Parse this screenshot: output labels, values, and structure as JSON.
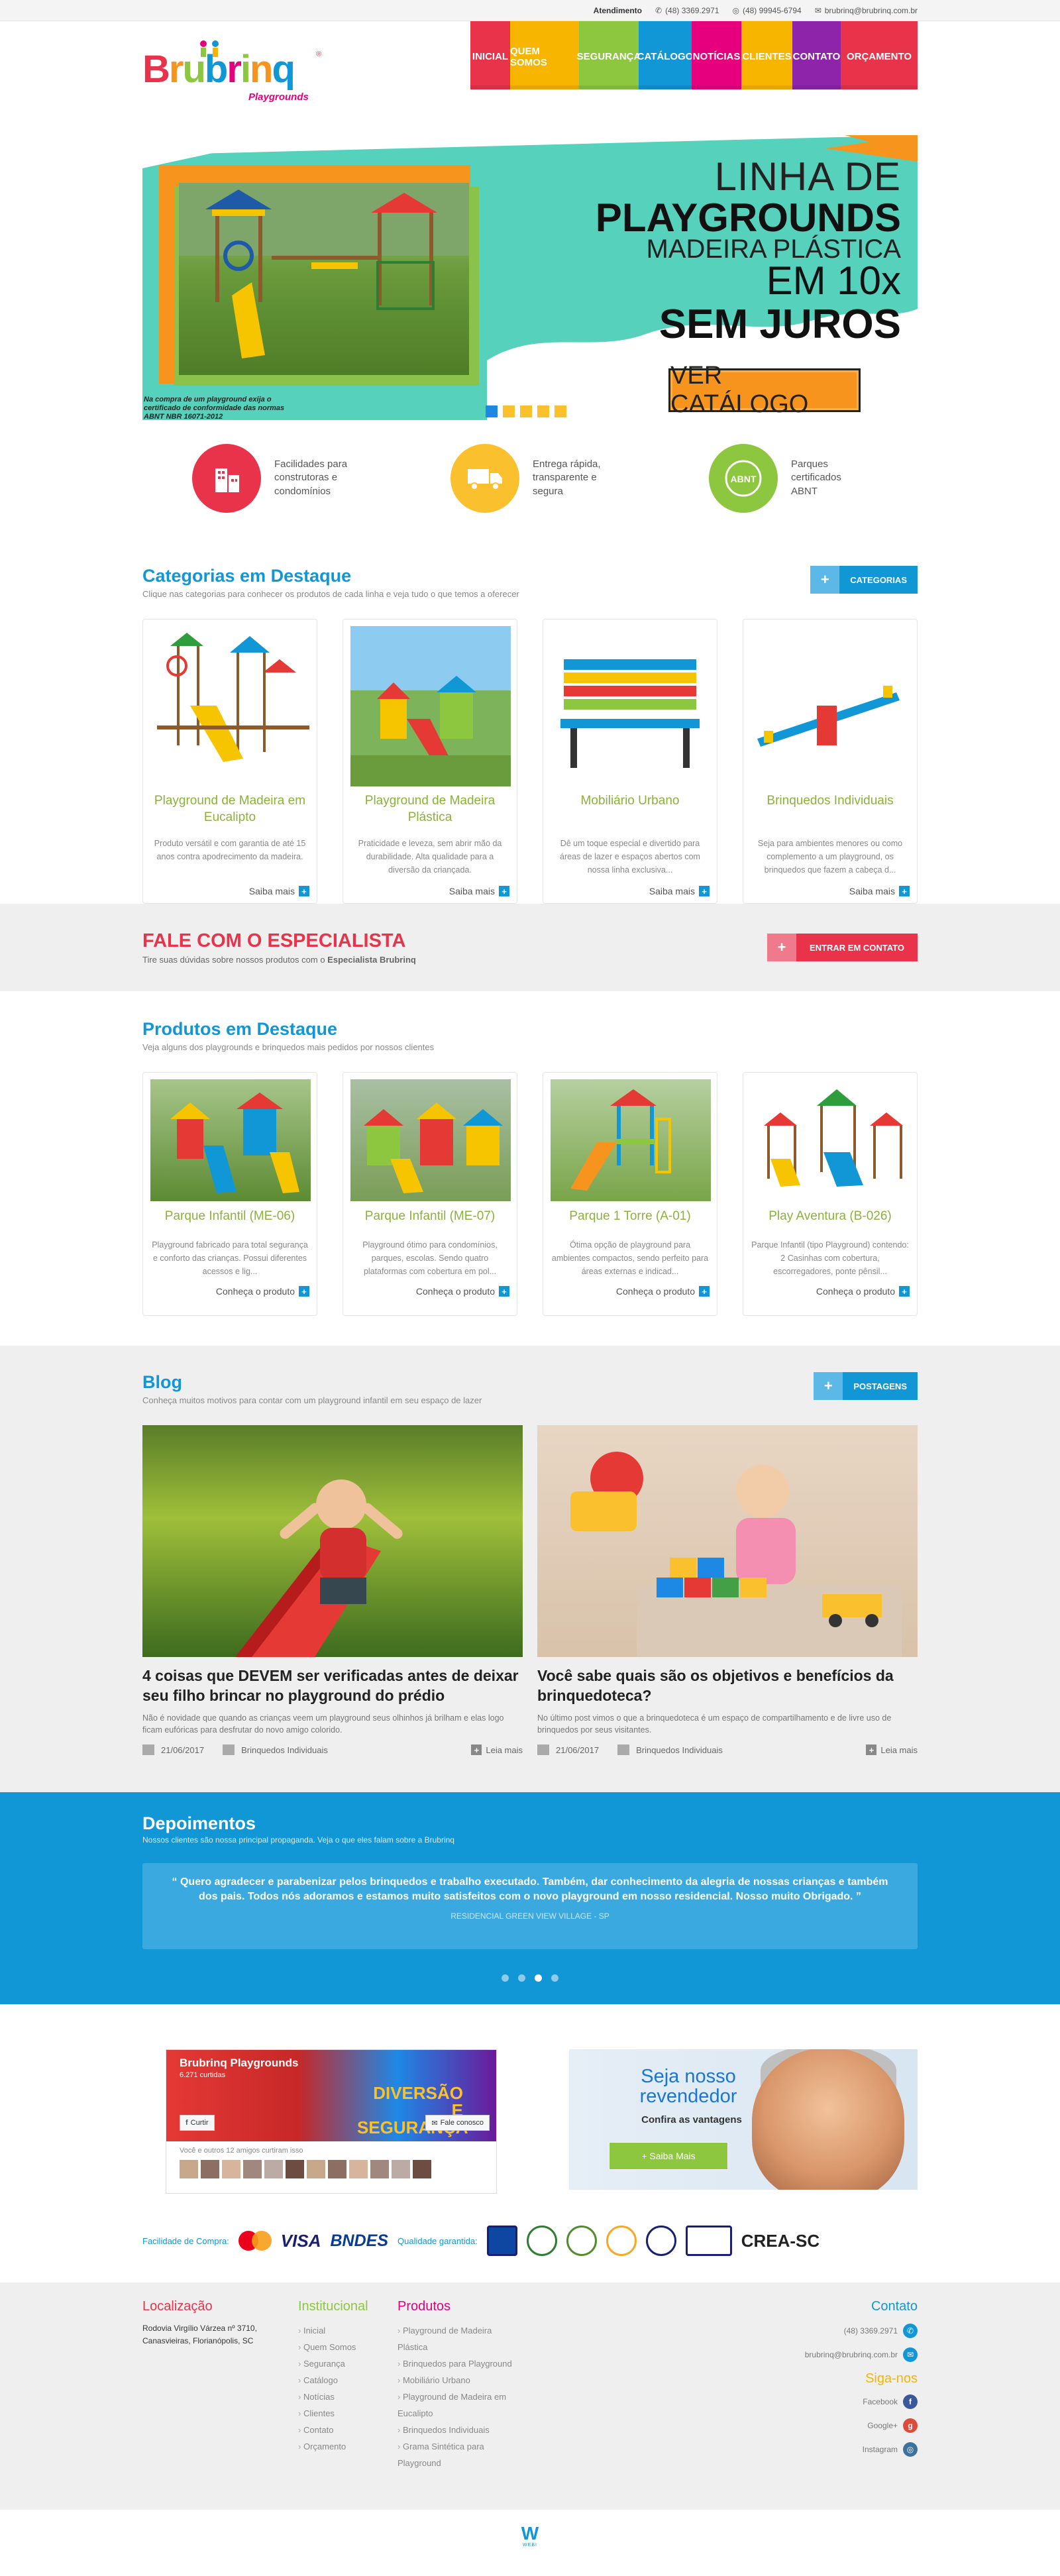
{
  "topbar": {
    "label": "Atendimento",
    "phone": "(48) 3369.2971",
    "whatsapp": "(48) 99945-6794",
    "email": "brubrinq@brubrinq.com.br"
  },
  "logo": {
    "name": "Brubrinq",
    "tagline": "Playgrounds"
  },
  "nav": [
    {
      "label": "INICIAL",
      "color": "#e8334a"
    },
    {
      "label": "QUEM SOMOS",
      "color": "#f7b500"
    },
    {
      "label": "SEGURANÇA",
      "color": "#8dc63f"
    },
    {
      "label": "CATÁLOGO",
      "color": "#1196d6"
    },
    {
      "label": "NOTÍCIAS",
      "color": "#e6007e"
    },
    {
      "label": "CLIENTES",
      "color": "#f7b500"
    },
    {
      "label": "CONTATO",
      "color": "#8e24aa"
    },
    {
      "label": "ORÇAMENTO",
      "color": "#e8334a"
    }
  ],
  "hero": {
    "line1": "LINHA DE",
    "line2": "PLAYGROUNDS",
    "line3": "MADEIRA PLÁSTICA",
    "line4": "EM 10x",
    "line5": "SEM JUROS",
    "cta": "VER CATÁLOGO",
    "cert": "Na compra de um playground exija o certificado de conformidade das normas ABNT NBR 16071-2012",
    "slides": 5,
    "active_slide": 1
  },
  "features": [
    {
      "text": "Facilidades para construtoras e condomínios",
      "color": "#e8334a",
      "icon": "building-icon"
    },
    {
      "text": "Entrega rápida, transparente e segura",
      "color": "#fbc02d",
      "icon": "truck-icon"
    },
    {
      "text": "Parques certificados ABNT",
      "color": "#8dc63f",
      "icon": "abnt-seal-icon"
    }
  ],
  "categories": {
    "title": "Categorias em Destaque",
    "subtitle": "Clique nas categorias para conhecer os produtos de cada linha e veja tudo o que temos a oferecer",
    "button": "CATEGORIAS",
    "items": [
      {
        "title": "Playground de Madeira em Eucalipto",
        "desc": "Produto versátil e com garantia de até 15 anos contra apodrecimento da madeira.",
        "more": "Saiba mais"
      },
      {
        "title": "Playground de Madeira Plástica",
        "desc": "Praticidade e leveza, sem abrir mão da durabilidade. Alta qualidade para a diversão da criançada.",
        "more": "Saiba mais"
      },
      {
        "title": "Mobiliário Urbano",
        "desc": "Dê um toque especial e divertido para áreas de lazer e espaços abertos com nossa linha exclusiva...",
        "more": "Saiba mais"
      },
      {
        "title": "Brinquedos Individuais",
        "desc": "Seja para ambientes menores ou como complemento a um playground, os brinquedos que fazem a cabeça d...",
        "more": "Saiba mais"
      }
    ]
  },
  "specialist": {
    "title": "FALE COM O ESPECIALISTA",
    "subtitle_pre": "Tire suas dúvidas sobre nossos produtos com o ",
    "subtitle_bold": "Especialista Brubrinq",
    "button": "ENTRAR EM CONTATO"
  },
  "products": {
    "title": "Produtos em Destaque",
    "subtitle": "Veja alguns dos playgrounds e brinquedos mais pedidos por nossos clientes",
    "items": [
      {
        "title": "Parque Infantil (ME-06)",
        "desc": "Playground fabricado para total segurança e conforto das crianças. Possui diferentes acessos e lig...",
        "more": "Conheça o produto"
      },
      {
        "title": "Parque Infantil (ME-07)",
        "desc": "Playground ótimo para condomínios, parques, escolas. Sendo quatro plataformas com cobertura em pol...",
        "more": "Conheça o produto"
      },
      {
        "title": "Parque 1 Torre (A-01)",
        "desc": "Ótima opção de playground para ambientes compactos, sendo perfeito para áreas externas e indicad...",
        "more": "Conheça o produto"
      },
      {
        "title": "Play Aventura (B-026)",
        "desc": "Parque Infantil (tipo Playground) contendo: 2 Casinhas com cobertura, escorregadores, ponte pênsil...",
        "more": "Conheça o produto"
      }
    ]
  },
  "blog": {
    "title": "Blog",
    "subtitle": "Conheça muitos motivos para contar com um playground infantil em seu espaço de lazer",
    "button": "POSTAGENS",
    "posts": [
      {
        "title": "4 coisas que DEVEM ser verificadas antes de deixar seu filho brincar no playground do prédio",
        "desc": "Não é novidade que quando as crianças veem um playground seus olhinhos já brilham e elas logo ficam eufóricas para desfrutar do novo amigo colorido.",
        "date": "21/06/2017",
        "category": "Brinquedos Individuais",
        "more": "Leia mais"
      },
      {
        "title": "Você sabe quais são os objetivos e benefícios da brinquedoteca?",
        "desc": "No último post vimos o que a brinquedoteca é um espaço de compartilhamento e de livre uso de brinquedos por seus visitantes.",
        "date": "21/06/2017",
        "category": "Brinquedos Individuais",
        "more": "Leia mais"
      }
    ]
  },
  "testimonials": {
    "title": "Depoimentos",
    "subtitle": "Nossos clientes são nossa principal propaganda. Veja o que eles falam sobre a Brubrinq",
    "quote": "Quero agradecer e parabenizar pelos brinquedos e trabalho executado. Também, dar conhecimento da alegria de nossas crianças e também dos pais. Todos nós adoramos e estamos muito satisfeitos com o novo playground em nosso residencial. Nosso muito Obrigado.",
    "author": "RESIDENCIAL GREEN VIEW VILLAGE - SP",
    "slides": 4,
    "active_slide": 3
  },
  "facebook": {
    "page": "Brubrinq Playgrounds",
    "likes": "6.271 curtidas",
    "cover_text": "DIVERSÃO E SEGURANÇA",
    "like_btn": "Curtir",
    "contact_btn": "Fale conosco",
    "friends": "Você e outros 12 amigos curtiram isso"
  },
  "reseller": {
    "title": "Seja nosso revendedor",
    "subtitle": "Confira as vantagens",
    "button": "+ Saiba Mais"
  },
  "partners": {
    "payment_label": "Facilidade de Compra:",
    "quality_label": "Qualidade garantida:",
    "visa": "VISA",
    "bndes": "BNDES",
    "crea": "CREA-SC"
  },
  "footer": {
    "location": {
      "title": "Localização",
      "address": "Rodovia Virgílio Várzea nº 3710, Canasvieiras, Florianópolis, SC"
    },
    "institutional": {
      "title": "Institucional",
      "links": [
        "Inicial",
        "Quem Somos",
        "Segurança",
        "Catálogo",
        "Notícias",
        "Clientes",
        "Contato",
        "Orçamento"
      ]
    },
    "products": {
      "title": "Produtos",
      "links": [
        "Playground de Madeira Plástica",
        "Brinquedos para Playground",
        "Mobiliário Urbano",
        "Playground de Madeira em Eucalipto",
        "Brinquedos Individuais",
        "Grama Sintética para Playground"
      ]
    },
    "contact": {
      "title": "Contato",
      "phone": "(48) 3369.2971",
      "email": "brubrinq@brubrinq.com.br"
    },
    "social": {
      "title": "Siga-nos",
      "facebook": "Facebook",
      "google": "Google+",
      "instagram": "Instagram"
    }
  },
  "credit": {
    "brand": "W",
    "label": "WEBI"
  }
}
